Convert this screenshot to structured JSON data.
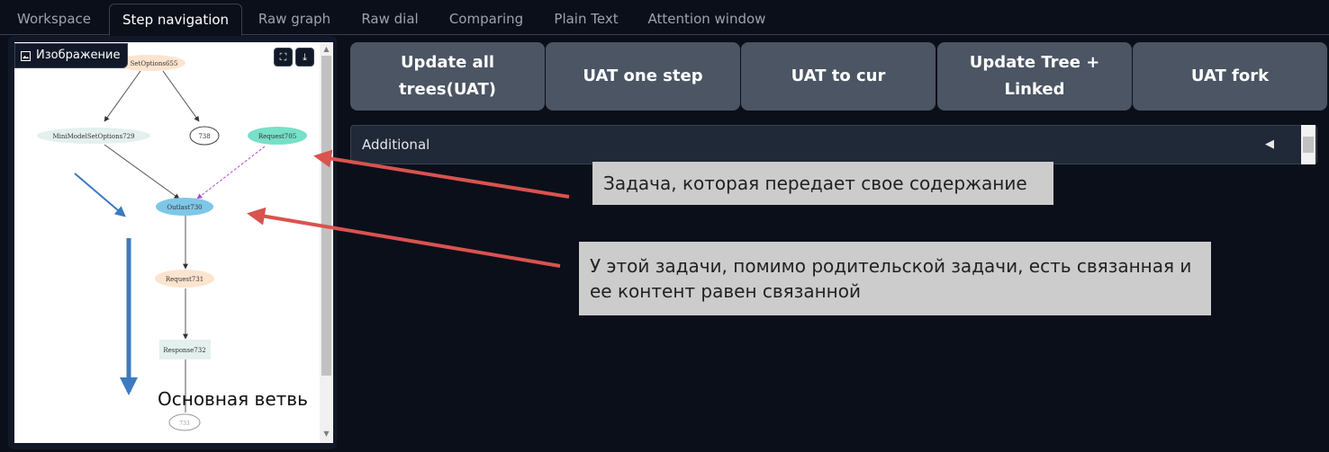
{
  "tabs": [
    {
      "label": "Workspace",
      "active": false
    },
    {
      "label": "Step navigation",
      "active": true
    },
    {
      "label": "Raw graph",
      "active": false
    },
    {
      "label": "Raw dial",
      "active": false
    },
    {
      "label": "Comparing",
      "active": false
    },
    {
      "label": "Plain Text",
      "active": false
    },
    {
      "label": "Attention window",
      "active": false
    }
  ],
  "image_panel": {
    "label": "Изображение",
    "nodes": {
      "top": "SetOptions655",
      "left": "MiniModelSetOptions729",
      "num738": "738",
      "request705": "Request705",
      "outlast730": "Outlast730",
      "request731": "Request731",
      "response732": "Response732",
      "bottom": "733"
    },
    "branch_label": "Основная ветвь"
  },
  "buttons": {
    "update_all": "Update all trees(UAT)",
    "uat_one_step": "UAT one step",
    "uat_to_cur": "UAT to cur",
    "update_tree_linked": "Update Tree + Linked",
    "uat_fork": "UAT fork"
  },
  "accordion": {
    "label": "Additional",
    "toggle": "◀"
  },
  "callouts": {
    "task_transfer": "Задача, которая передает свое содержание",
    "linked_task": "У этой задачи, помимо родительской задачи, есть связанная и ее контент равен связанной"
  },
  "colors": {
    "background": "#0b0f19",
    "button": "#4b5563",
    "arrow_red": "#d9534f",
    "arrow_blue": "#3b7bbf"
  }
}
